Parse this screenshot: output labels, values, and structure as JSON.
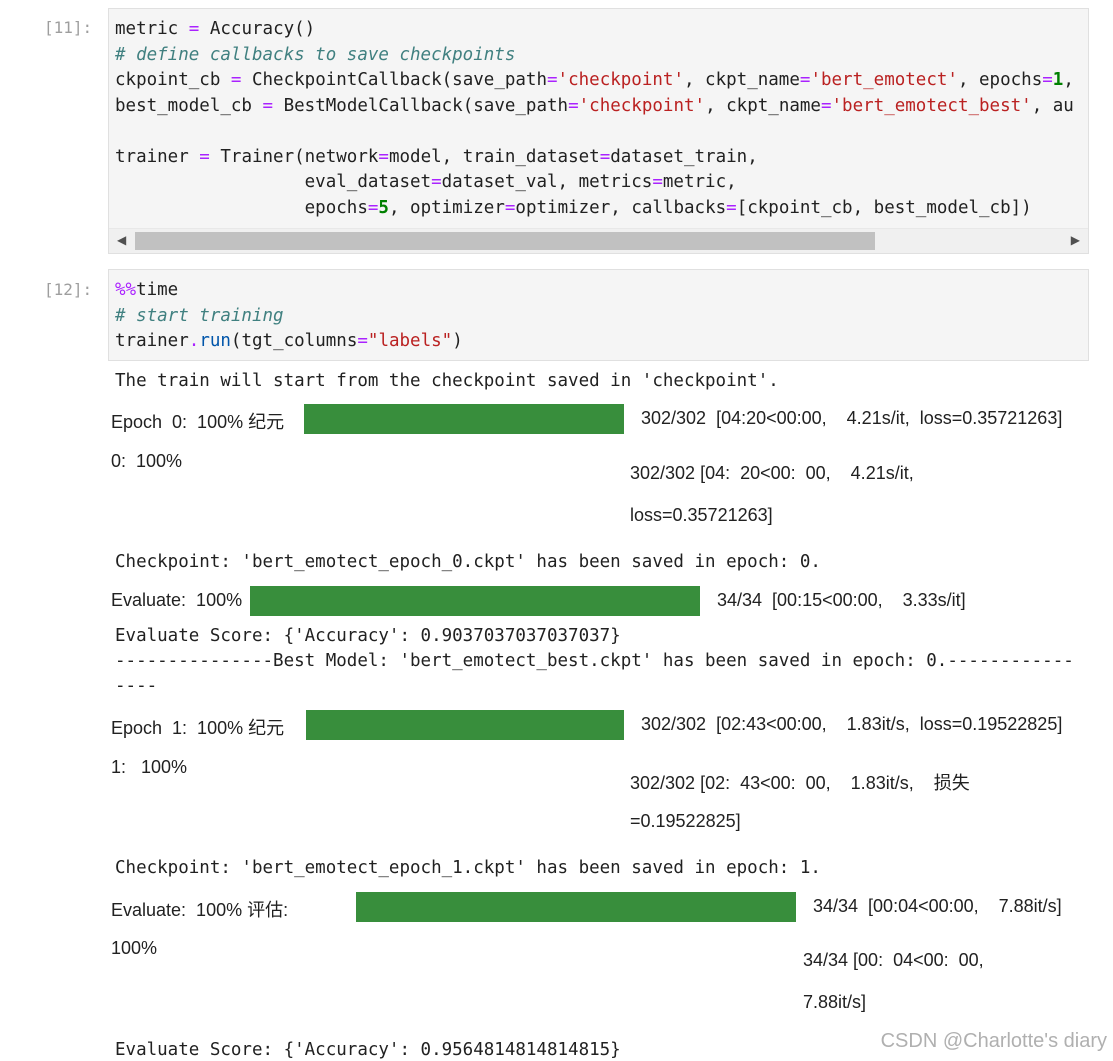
{
  "cells": [
    {
      "prompt": "[11]:",
      "lines": [
        [
          {
            "t": "metric "
          },
          {
            "t": "=",
            "c": "op"
          },
          {
            "t": " Accuracy()"
          }
        ],
        [
          {
            "t": "# define callbacks to save checkpoints",
            "c": "kw-c"
          }
        ],
        [
          {
            "t": "ckpoint_cb "
          },
          {
            "t": "=",
            "c": "op"
          },
          {
            "t": " CheckpointCallback(save_path"
          },
          {
            "t": "=",
            "c": "op"
          },
          {
            "t": "'checkpoint'",
            "c": "str"
          },
          {
            "t": ", ckpt_name"
          },
          {
            "t": "=",
            "c": "op"
          },
          {
            "t": "'bert_emotect'",
            "c": "str"
          },
          {
            "t": ", epochs"
          },
          {
            "t": "=",
            "c": "op"
          },
          {
            "t": "1",
            "c": "num"
          },
          {
            "t": ","
          }
        ],
        [
          {
            "t": "best_model_cb "
          },
          {
            "t": "=",
            "c": "op"
          },
          {
            "t": " BestModelCallback(save_path"
          },
          {
            "t": "=",
            "c": "op"
          },
          {
            "t": "'checkpoint'",
            "c": "str"
          },
          {
            "t": ", ckpt_name"
          },
          {
            "t": "=",
            "c": "op"
          },
          {
            "t": "'bert_emotect_best'",
            "c": "str"
          },
          {
            "t": ", au"
          }
        ],
        [
          {
            "t": ""
          }
        ],
        [
          {
            "t": "trainer "
          },
          {
            "t": "=",
            "c": "op"
          },
          {
            "t": " Trainer(network"
          },
          {
            "t": "=",
            "c": "op"
          },
          {
            "t": "model, train_dataset"
          },
          {
            "t": "=",
            "c": "op"
          },
          {
            "t": "dataset_train,"
          }
        ],
        [
          {
            "t": "                  eval_dataset"
          },
          {
            "t": "=",
            "c": "op"
          },
          {
            "t": "dataset_val, metrics"
          },
          {
            "t": "=",
            "c": "op"
          },
          {
            "t": "metric,"
          }
        ],
        [
          {
            "t": "                  epochs"
          },
          {
            "t": "=",
            "c": "op"
          },
          {
            "t": "5",
            "c": "num"
          },
          {
            "t": ", optimizer"
          },
          {
            "t": "=",
            "c": "op"
          },
          {
            "t": "optimizer, callbacks"
          },
          {
            "t": "=",
            "c": "op"
          },
          {
            "t": "[ckpoint_cb, best_model_cb])"
          }
        ]
      ],
      "scroll_left": "◀",
      "scroll_right": "▶"
    },
    {
      "prompt": "[12]:",
      "lines": [
        [
          {
            "t": "%%",
            "c": "mag"
          },
          {
            "t": "time"
          }
        ],
        [
          {
            "t": "# start training",
            "c": "kw-c"
          }
        ],
        [
          {
            "t": "trainer"
          },
          {
            "t": ".",
            "c": "op"
          },
          {
            "t": "run",
            "c": "fn"
          },
          {
            "t": "(tgt_columns"
          },
          {
            "t": "=",
            "c": "op"
          },
          {
            "t": "\"labels\"",
            "c": "str"
          },
          {
            "t": ")"
          }
        ]
      ]
    }
  ],
  "output": {
    "start_msg": "The train will start from the checkpoint saved in 'checkpoint'.",
    "epoch0": {
      "label": "Epoch  0:  100% 纪元",
      "progress": 1.0,
      "stats": "302/302  [04:20<00:00,    4.21s/it,  loss=0.35721263]",
      "trans_left": "0:  100%",
      "trans_line1": "302/302 [04:  20<00:  00,    4.21s/it,",
      "trans_line2": "loss=0.35721263]"
    },
    "ckpt0": "Checkpoint: 'bert_emotect_epoch_0.ckpt' has been saved in epoch: 0.",
    "eval0": {
      "label": "Evaluate:  100%",
      "progress": 1.0,
      "stats": "34/34  [00:15<00:00,    3.33s/it]"
    },
    "score0": "Evaluate Score: {'Accuracy': 0.9037037037037037}",
    "best0_line1": "---------------Best Model: 'bert_emotect_best.ckpt' has been saved in epoch: 0.------------",
    "best0_line2": "----",
    "epoch1": {
      "label": "Epoch  1:  100% 纪元",
      "progress": 1.0,
      "stats": "302/302  [02:43<00:00,    1.83it/s,  loss=0.19522825]",
      "trans_left": "1:   100%",
      "trans_line1": "302/302 [02:  43<00:  00,    1.83it/s,    损失",
      "trans_line2": "=0.19522825]"
    },
    "ckpt1": "Checkpoint: 'bert_emotect_epoch_1.ckpt' has been saved in epoch: 1.",
    "eval1": {
      "label": "Evaluate:  100% 评估:",
      "progress": 1.0,
      "stats": "34/34  [00:04<00:00,    7.88it/s]",
      "trans_left": "100%",
      "trans_line1": "34/34 [00:  04<00:  00,",
      "trans_line2": "7.88it/s]"
    },
    "score1": "Evaluate Score: {'Accuracy': 0.9564814814814815}"
  },
  "watermark": "CSDN @Charlotte's diary",
  "colors": {
    "progress_bar": "#388e3c",
    "prompt": "#9e9e9e",
    "cell_bg": "#f5f5f5"
  }
}
